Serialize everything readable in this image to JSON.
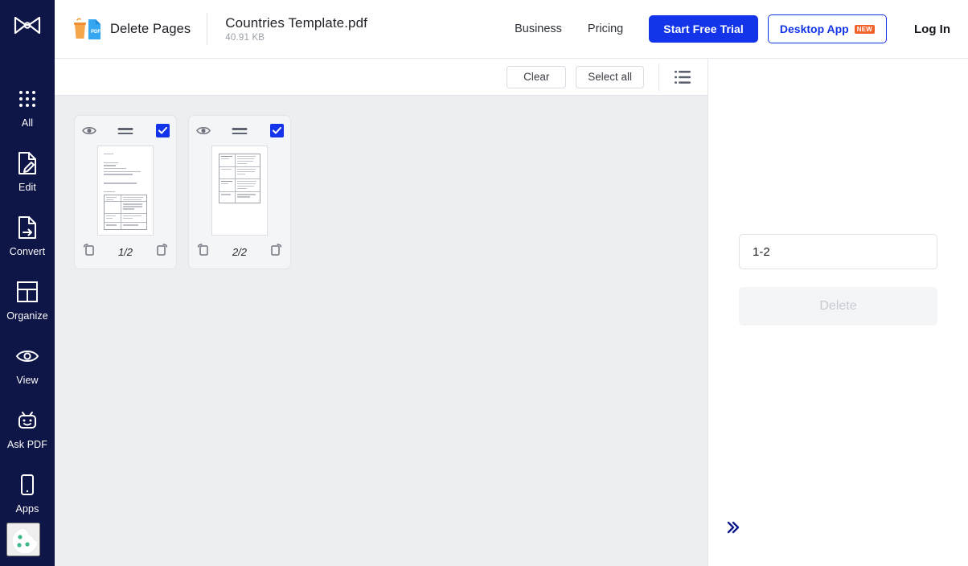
{
  "sidebar": {
    "logo_name": "smallpdf-logo",
    "items": [
      {
        "label": "All",
        "icon": "grid-dots-icon"
      },
      {
        "label": "Edit",
        "icon": "document-pencil-icon"
      },
      {
        "label": "Convert",
        "icon": "document-arrow-icon"
      },
      {
        "label": "Organize",
        "icon": "layout-grid-icon"
      },
      {
        "label": "View",
        "icon": "eye-icon"
      },
      {
        "label": "Ask PDF",
        "icon": "robot-icon"
      },
      {
        "label": "Apps",
        "icon": "mobile-phone-icon"
      }
    ],
    "cookie_label": "cookie-preferences-icon",
    "background_color": "#0e1547"
  },
  "header": {
    "tool_title": "Delete Pages",
    "tool_icon": "trash-pdf-icon",
    "file_name": "Countries Template.pdf",
    "file_size": "40.91 KB",
    "nav": [
      {
        "label": "Business"
      },
      {
        "label": "Pricing"
      }
    ],
    "cta_primary": "Start Free Trial",
    "cta_secondary": "Desktop App",
    "cta_secondary_badge": "NEW",
    "login": "Log In",
    "accent_color": "#1334e8",
    "badge_color": "#f4622c"
  },
  "toolbar": {
    "clear_label": "Clear",
    "select_all_label": "Select all",
    "list_view_icon": "list-view-icon"
  },
  "pages": [
    {
      "number_label": "1/2",
      "selected": true,
      "preview_icon": "eye-icon",
      "drag_icon": "drag-handle-icon",
      "rotate_left_icon": "rotate-left-icon",
      "rotate_right_icon": "rotate-right-icon"
    },
    {
      "number_label": "2/2",
      "selected": true,
      "preview_icon": "eye-icon",
      "drag_icon": "drag-handle-icon",
      "rotate_left_icon": "rotate-left-icon",
      "rotate_right_icon": "rotate-right-icon"
    }
  ],
  "right_panel": {
    "range_value": "1-2",
    "range_placeholder": "1-2",
    "delete_label": "Delete",
    "delete_enabled": false,
    "expand_icon": "double-chevron-right-icon"
  }
}
